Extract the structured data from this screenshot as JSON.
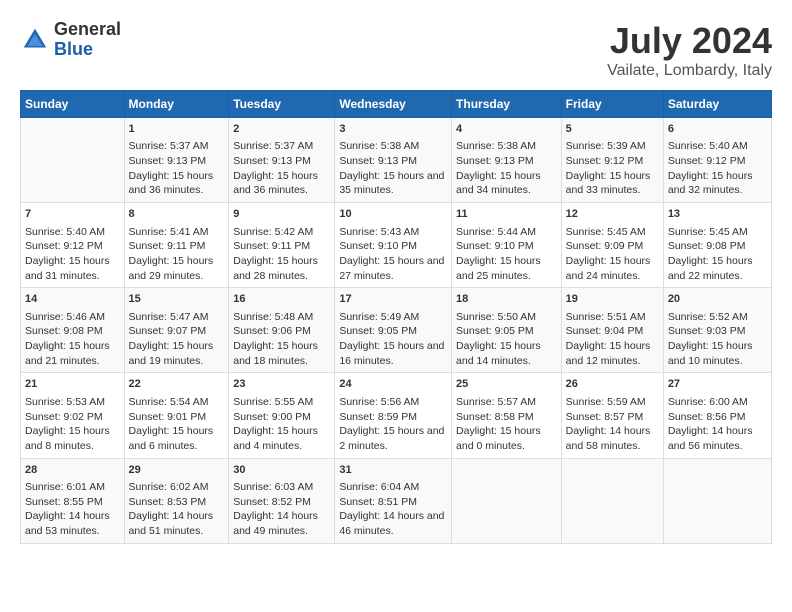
{
  "logo": {
    "general": "General",
    "blue": "Blue"
  },
  "title": "July 2024",
  "subtitle": "Vailate, Lombardy, Italy",
  "days_of_week": [
    "Sunday",
    "Monday",
    "Tuesday",
    "Wednesday",
    "Thursday",
    "Friday",
    "Saturday"
  ],
  "weeks": [
    [
      {
        "day": "",
        "sunrise": "",
        "sunset": "",
        "daylight": ""
      },
      {
        "day": "1",
        "sunrise": "Sunrise: 5:37 AM",
        "sunset": "Sunset: 9:13 PM",
        "daylight": "Daylight: 15 hours and 36 minutes."
      },
      {
        "day": "2",
        "sunrise": "Sunrise: 5:37 AM",
        "sunset": "Sunset: 9:13 PM",
        "daylight": "Daylight: 15 hours and 36 minutes."
      },
      {
        "day": "3",
        "sunrise": "Sunrise: 5:38 AM",
        "sunset": "Sunset: 9:13 PM",
        "daylight": "Daylight: 15 hours and 35 minutes."
      },
      {
        "day": "4",
        "sunrise": "Sunrise: 5:38 AM",
        "sunset": "Sunset: 9:13 PM",
        "daylight": "Daylight: 15 hours and 34 minutes."
      },
      {
        "day": "5",
        "sunrise": "Sunrise: 5:39 AM",
        "sunset": "Sunset: 9:12 PM",
        "daylight": "Daylight: 15 hours and 33 minutes."
      },
      {
        "day": "6",
        "sunrise": "Sunrise: 5:40 AM",
        "sunset": "Sunset: 9:12 PM",
        "daylight": "Daylight: 15 hours and 32 minutes."
      }
    ],
    [
      {
        "day": "7",
        "sunrise": "Sunrise: 5:40 AM",
        "sunset": "Sunset: 9:12 PM",
        "daylight": "Daylight: 15 hours and 31 minutes."
      },
      {
        "day": "8",
        "sunrise": "Sunrise: 5:41 AM",
        "sunset": "Sunset: 9:11 PM",
        "daylight": "Daylight: 15 hours and 29 minutes."
      },
      {
        "day": "9",
        "sunrise": "Sunrise: 5:42 AM",
        "sunset": "Sunset: 9:11 PM",
        "daylight": "Daylight: 15 hours and 28 minutes."
      },
      {
        "day": "10",
        "sunrise": "Sunrise: 5:43 AM",
        "sunset": "Sunset: 9:10 PM",
        "daylight": "Daylight: 15 hours and 27 minutes."
      },
      {
        "day": "11",
        "sunrise": "Sunrise: 5:44 AM",
        "sunset": "Sunset: 9:10 PM",
        "daylight": "Daylight: 15 hours and 25 minutes."
      },
      {
        "day": "12",
        "sunrise": "Sunrise: 5:45 AM",
        "sunset": "Sunset: 9:09 PM",
        "daylight": "Daylight: 15 hours and 24 minutes."
      },
      {
        "day": "13",
        "sunrise": "Sunrise: 5:45 AM",
        "sunset": "Sunset: 9:08 PM",
        "daylight": "Daylight: 15 hours and 22 minutes."
      }
    ],
    [
      {
        "day": "14",
        "sunrise": "Sunrise: 5:46 AM",
        "sunset": "Sunset: 9:08 PM",
        "daylight": "Daylight: 15 hours and 21 minutes."
      },
      {
        "day": "15",
        "sunrise": "Sunrise: 5:47 AM",
        "sunset": "Sunset: 9:07 PM",
        "daylight": "Daylight: 15 hours and 19 minutes."
      },
      {
        "day": "16",
        "sunrise": "Sunrise: 5:48 AM",
        "sunset": "Sunset: 9:06 PM",
        "daylight": "Daylight: 15 hours and 18 minutes."
      },
      {
        "day": "17",
        "sunrise": "Sunrise: 5:49 AM",
        "sunset": "Sunset: 9:05 PM",
        "daylight": "Daylight: 15 hours and 16 minutes."
      },
      {
        "day": "18",
        "sunrise": "Sunrise: 5:50 AM",
        "sunset": "Sunset: 9:05 PM",
        "daylight": "Daylight: 15 hours and 14 minutes."
      },
      {
        "day": "19",
        "sunrise": "Sunrise: 5:51 AM",
        "sunset": "Sunset: 9:04 PM",
        "daylight": "Daylight: 15 hours and 12 minutes."
      },
      {
        "day": "20",
        "sunrise": "Sunrise: 5:52 AM",
        "sunset": "Sunset: 9:03 PM",
        "daylight": "Daylight: 15 hours and 10 minutes."
      }
    ],
    [
      {
        "day": "21",
        "sunrise": "Sunrise: 5:53 AM",
        "sunset": "Sunset: 9:02 PM",
        "daylight": "Daylight: 15 hours and 8 minutes."
      },
      {
        "day": "22",
        "sunrise": "Sunrise: 5:54 AM",
        "sunset": "Sunset: 9:01 PM",
        "daylight": "Daylight: 15 hours and 6 minutes."
      },
      {
        "day": "23",
        "sunrise": "Sunrise: 5:55 AM",
        "sunset": "Sunset: 9:00 PM",
        "daylight": "Daylight: 15 hours and 4 minutes."
      },
      {
        "day": "24",
        "sunrise": "Sunrise: 5:56 AM",
        "sunset": "Sunset: 8:59 PM",
        "daylight": "Daylight: 15 hours and 2 minutes."
      },
      {
        "day": "25",
        "sunrise": "Sunrise: 5:57 AM",
        "sunset": "Sunset: 8:58 PM",
        "daylight": "Daylight: 15 hours and 0 minutes."
      },
      {
        "day": "26",
        "sunrise": "Sunrise: 5:59 AM",
        "sunset": "Sunset: 8:57 PM",
        "daylight": "Daylight: 14 hours and 58 minutes."
      },
      {
        "day": "27",
        "sunrise": "Sunrise: 6:00 AM",
        "sunset": "Sunset: 8:56 PM",
        "daylight": "Daylight: 14 hours and 56 minutes."
      }
    ],
    [
      {
        "day": "28",
        "sunrise": "Sunrise: 6:01 AM",
        "sunset": "Sunset: 8:55 PM",
        "daylight": "Daylight: 14 hours and 53 minutes."
      },
      {
        "day": "29",
        "sunrise": "Sunrise: 6:02 AM",
        "sunset": "Sunset: 8:53 PM",
        "daylight": "Daylight: 14 hours and 51 minutes."
      },
      {
        "day": "30",
        "sunrise": "Sunrise: 6:03 AM",
        "sunset": "Sunset: 8:52 PM",
        "daylight": "Daylight: 14 hours and 49 minutes."
      },
      {
        "day": "31",
        "sunrise": "Sunrise: 6:04 AM",
        "sunset": "Sunset: 8:51 PM",
        "daylight": "Daylight: 14 hours and 46 minutes."
      },
      {
        "day": "",
        "sunrise": "",
        "sunset": "",
        "daylight": ""
      },
      {
        "day": "",
        "sunrise": "",
        "sunset": "",
        "daylight": ""
      },
      {
        "day": "",
        "sunrise": "",
        "sunset": "",
        "daylight": ""
      }
    ]
  ]
}
